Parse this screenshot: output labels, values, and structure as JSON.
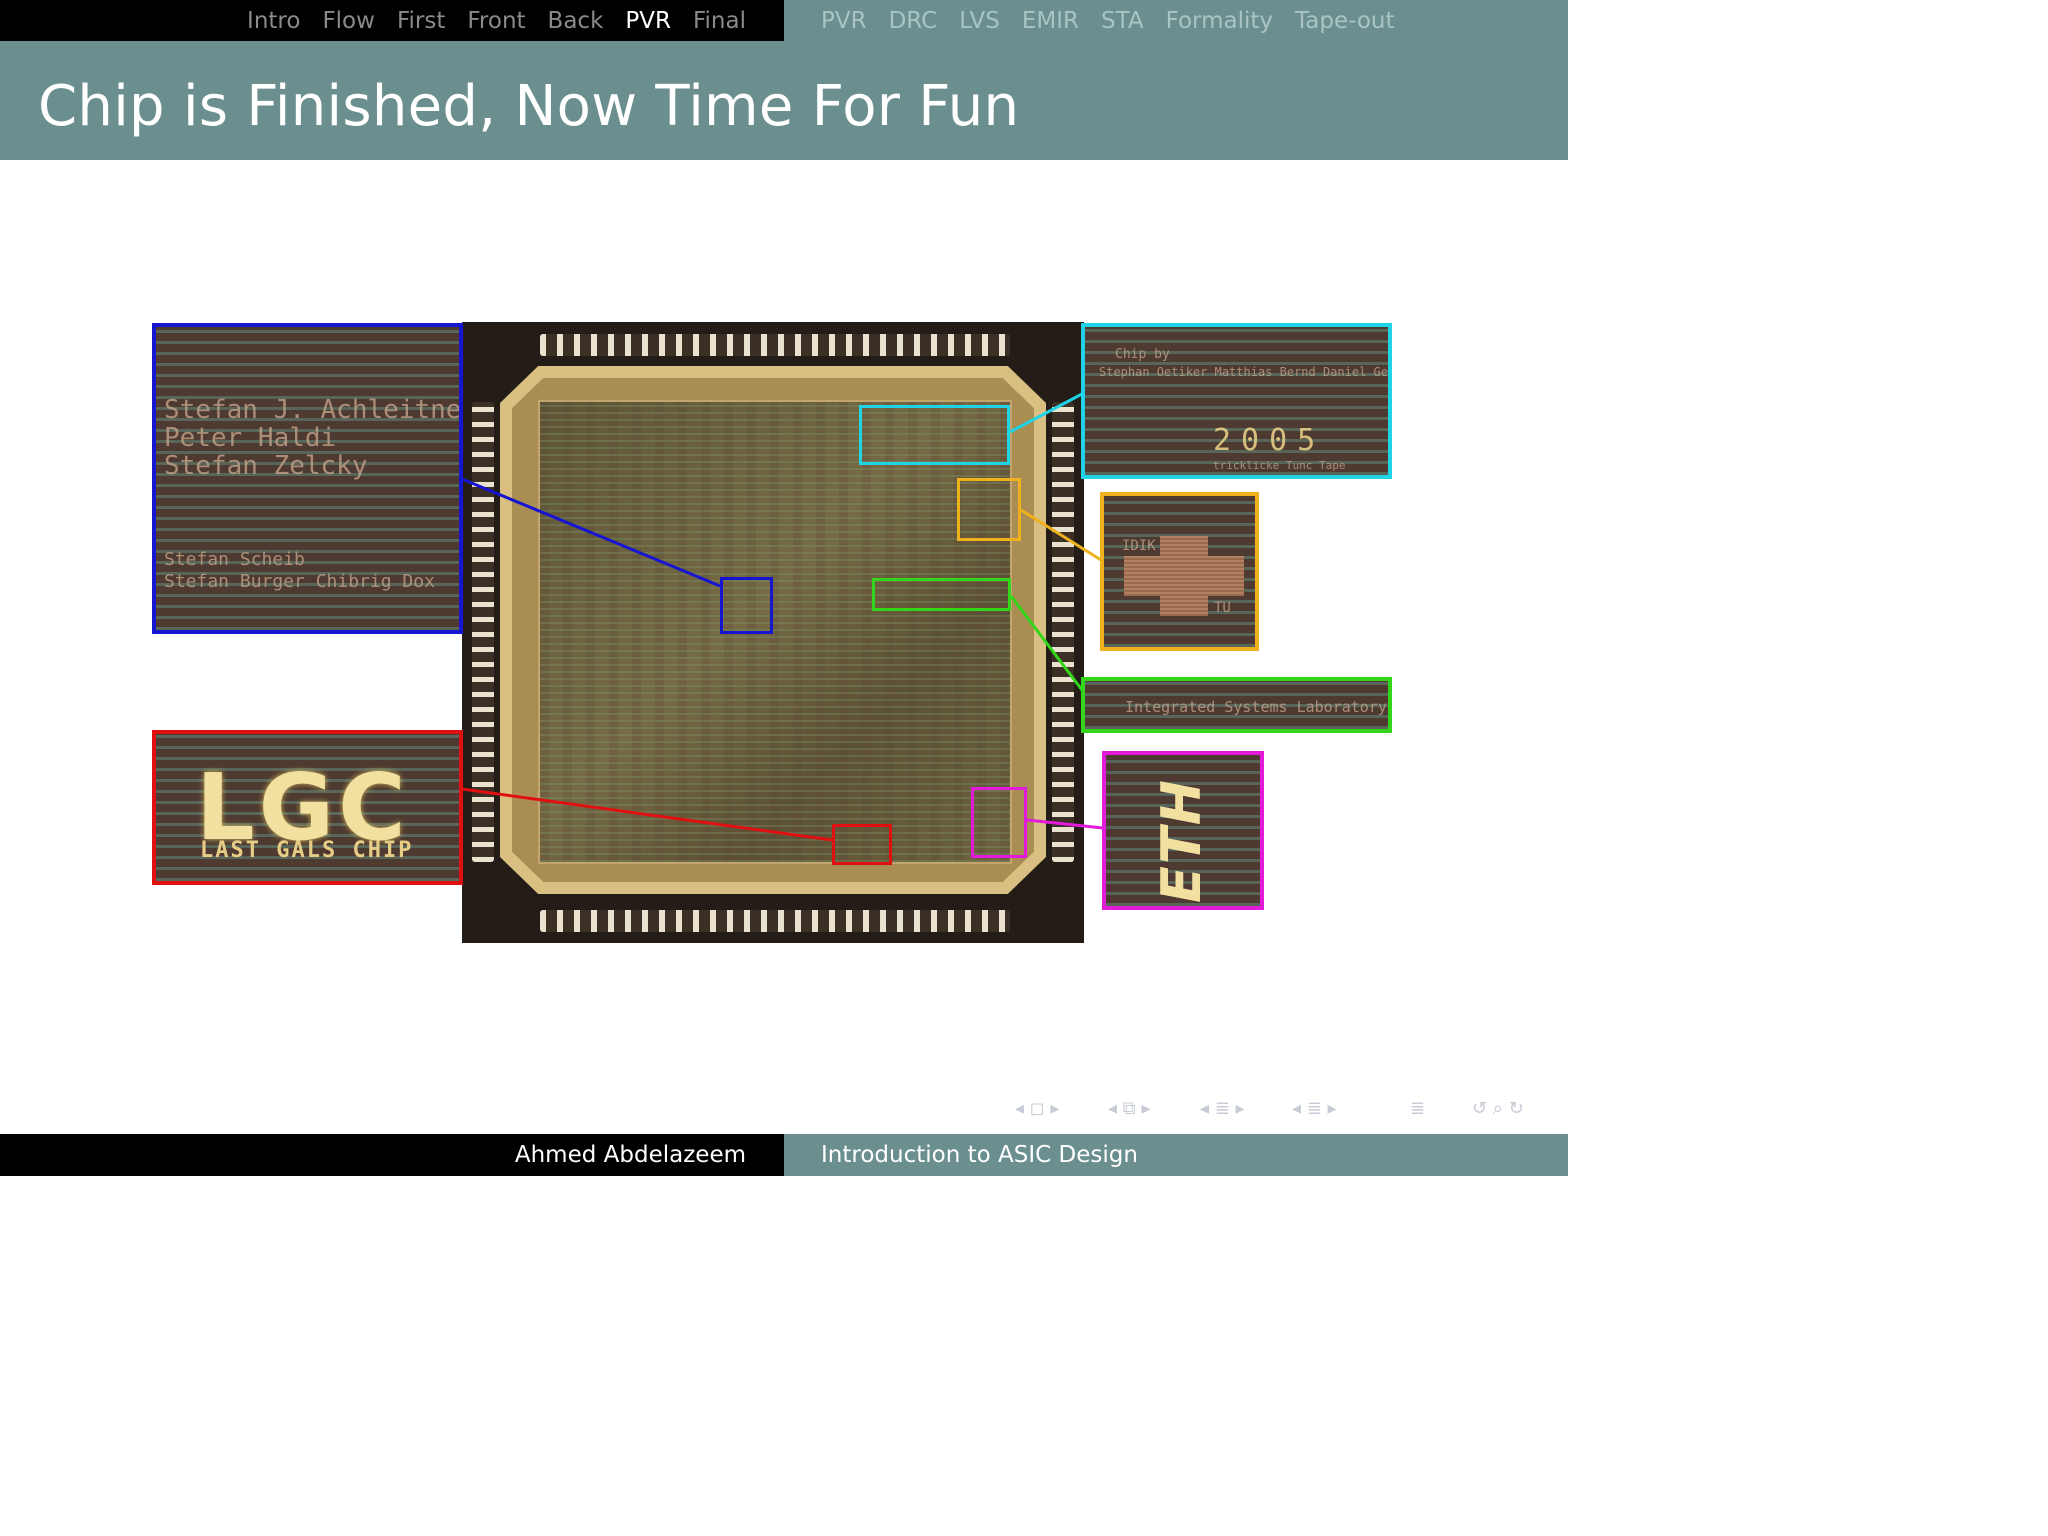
{
  "nav": {
    "sections": [
      {
        "label": "Intro",
        "active": false
      },
      {
        "label": "Flow",
        "active": false
      },
      {
        "label": "First",
        "active": false
      },
      {
        "label": "Front",
        "active": false
      },
      {
        "label": "Back",
        "active": false
      },
      {
        "label": "PVR",
        "active": true
      },
      {
        "label": "Final",
        "active": false
      }
    ],
    "subsections": [
      {
        "label": "PVR",
        "active": false
      },
      {
        "label": "DRC",
        "active": false
      },
      {
        "label": "LVS",
        "active": false
      },
      {
        "label": "EMIR",
        "active": false
      },
      {
        "label": "STA",
        "active": false
      },
      {
        "label": "Formality",
        "active": true
      },
      {
        "label": "Tape-out",
        "active": false
      }
    ]
  },
  "slide": {
    "title": "Chip is Finished, Now Time For Fun"
  },
  "figure": {
    "insets": {
      "names": {
        "lines": [
          "Stefan J. Achleitner",
          "Peter Haldi",
          "Stefan Zelcky"
        ],
        "lines2": [
          "Stefan Scheib",
          "Stefan Burger  Chibrig Dox"
        ]
      },
      "logo": {
        "main": "LGC",
        "sub": "LAST GALS CHIP"
      },
      "credits": {
        "line1": "Chip by",
        "line2": "Stephan Oetiker  Matthias Bernd  Daniel Gex",
        "year": "2005",
        "line3": "tricklicke  Tunc  Tape"
      },
      "icon": {
        "left": "IDIK",
        "right": "TU"
      },
      "lab": {
        "text": "Integrated Systems Laboratory"
      },
      "eth": {
        "text": "ETH"
      }
    },
    "colors": {
      "blue": "#1515d2",
      "red": "#e01010",
      "cyan": "#1fd4e6",
      "orange": "#f0b21c",
      "green": "#33d61a",
      "magenta": "#e31ad9"
    }
  },
  "navsymbols": {
    "frame": "◂ ◻ ▸",
    "subsection": "◂ ⧉ ▸",
    "section": "◂ ≣ ▸",
    "presentation": "◂ ≣ ▸",
    "outline": "≣",
    "search": "↺ ⌕ ↻"
  },
  "footer": {
    "author": "Ahmed Abdelazeem",
    "title": "Introduction to ASIC Design"
  }
}
